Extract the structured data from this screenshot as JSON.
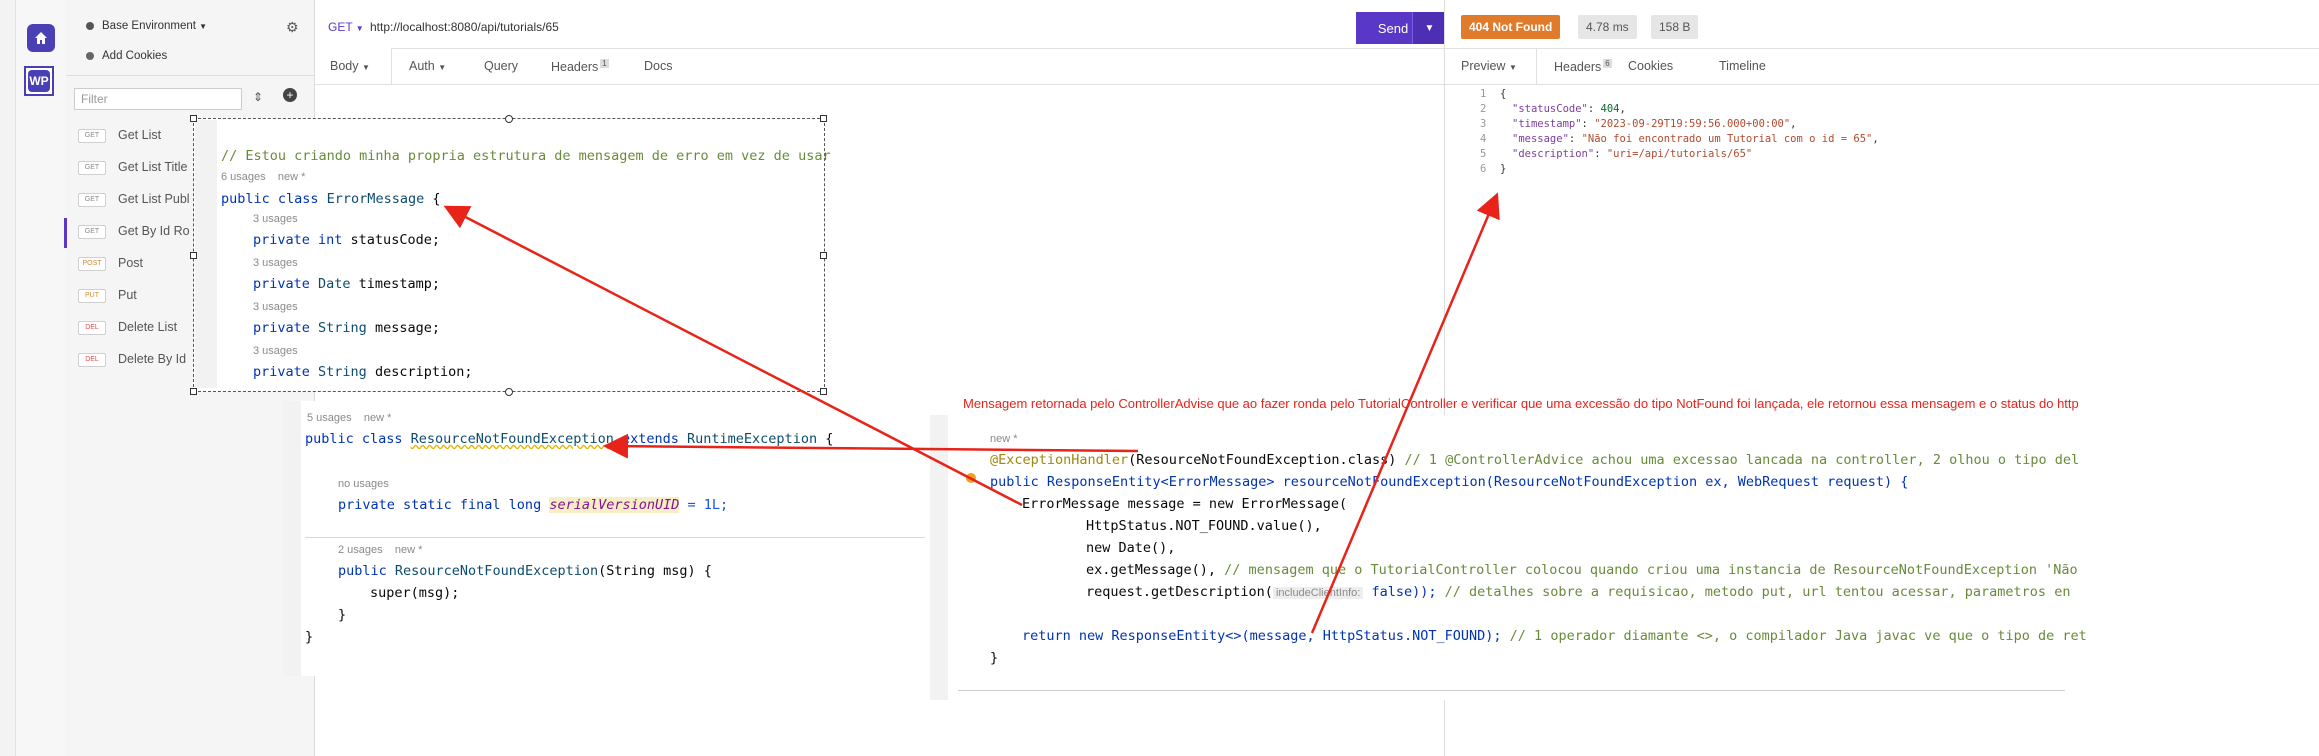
{
  "rail": {
    "home_icon": "home-icon",
    "workspace_initials": "WP"
  },
  "sidebar": {
    "environment": "Base Environment",
    "add_cookies": "Add Cookies",
    "filter_placeholder": "Filter",
    "requests": [
      {
        "method": "GET",
        "name": "Get List"
      },
      {
        "method": "GET",
        "name": "Get List Title"
      },
      {
        "method": "GET",
        "name": "Get List Publ"
      },
      {
        "method": "GET",
        "name": "Get By Id Ro"
      },
      {
        "method": "POST",
        "name": "Post"
      },
      {
        "method": "PUT",
        "name": "Put"
      },
      {
        "method": "DEL",
        "name": "Delete List"
      },
      {
        "method": "DEL",
        "name": "Delete By Id"
      }
    ]
  },
  "request": {
    "method": "GET",
    "url": "http://localhost:8080/api/tutorials/65",
    "send_label": "Send",
    "tabs": [
      "Body",
      "Auth",
      "Query",
      "Headers",
      "Docs"
    ],
    "headers_count": "1"
  },
  "response": {
    "status": "404 Not Found",
    "time": "4.78 ms",
    "size": "158 B",
    "tabs": [
      "Preview",
      "Headers",
      "Cookies",
      "Timeline"
    ],
    "headers_count": "6",
    "json_lines": [
      {
        "n": "1",
        "text": "{"
      },
      {
        "n": "2",
        "key": "\"statusCode\"",
        "value": "404",
        "kind": "num"
      },
      {
        "n": "3",
        "key": "\"timestamp\"",
        "value": "\"2023-09-29T19:59:56.000+00:00\"",
        "kind": "str"
      },
      {
        "n": "4",
        "key": "\"message\"",
        "value": "\"Não foi encontrado um Tutorial com o id = 65\"",
        "kind": "str"
      },
      {
        "n": "5",
        "key": "\"description\"",
        "value": "\"uri=/api/tutorials/65\"",
        "kind": "str"
      },
      {
        "n": "6",
        "text": "}"
      }
    ]
  },
  "code1": {
    "comment": "// Estou criando minha propria estrutura de mensagem de erro em vez de usar",
    "usages_class": "6 usages",
    "new_tag": "new *",
    "class_decl_kw": "public class ",
    "class_name": "ErrorMessage",
    "brace": " {",
    "fields": [
      {
        "usages": "3 usages",
        "kw": "private ",
        "type": "int",
        "name": " statusCode;"
      },
      {
        "usages": "3 usages",
        "kw": "private ",
        "type": "Date",
        "name": " timestamp;"
      },
      {
        "usages": "3 usages",
        "kw": "private ",
        "type": "String",
        "name": " message;"
      },
      {
        "usages": "3 usages",
        "kw": "private ",
        "type": "String",
        "name": " description;"
      }
    ]
  },
  "code2": {
    "usages": "5 usages",
    "new_tag": "new *",
    "decl_kw": "public class ",
    "class_name": "ResourceNotFoundException",
    "extends_kw": " extends ",
    "parent": "RuntimeException",
    "brace": " {",
    "no_usages": "no usages",
    "serial_kw": "private static final long ",
    "serial_name": "serialVersionUID",
    "serial_val": " = 1L;",
    "ctor_usages": "2 usages",
    "ctor_new": "new *",
    "ctor_kw": "public ",
    "ctor_name": "ResourceNotFoundException",
    "ctor_params": "(String msg) {",
    "super_call": "super(msg);",
    "close_inner": "}",
    "close_outer": "}"
  },
  "code3": {
    "new_tag": "new *",
    "line1_ann": "@ExceptionHandler",
    "line1_rest": "(ResourceNotFoundException.class)",
    "line1_comment": " // 1 @ControllerAdvice achou uma excessao lancada na controller, 2 olhou o tipo del",
    "line2": "public ResponseEntity<ErrorMessage> resourceNotFoundException(ResourceNotFoundException ex, WebRequest request) {",
    "line3": "ErrorMessage message = new ErrorMessage(",
    "line4": "HttpStatus.NOT_FOUND.value(),",
    "line5": "new Date(),",
    "line6": "ex.getMessage(),",
    "line6_comment": " // mensagem que o TutorialController colocou quando criou uma instancia de ResourceNotFoundException 'Não",
    "line7_a": "request.getDescription(",
    "line7_hint": "includeClientInfo:",
    "line7_b": " false));",
    "line7_comment": " // detalhes sobre a requisicao, metodo put, url tentou acessar, parametros en",
    "line8": "return new ResponseEntity<>(message, HttpStatus.NOT_FOUND);",
    "line8_comment": " // 1 operador diamante <>, o compilador Java javac ve que o tipo de ret",
    "line9": "}"
  },
  "annotation": "Mensagem retornada pelo ControllerAdvise que ao fazer ronda pelo TutorialController e verificar que uma excessão do tipo NotFound foi lançada, ele retornou essa mensagem e o status do http",
  "colors": {
    "accent": "#5a38c7",
    "status_bg": "#e07b2c",
    "arrow": "#e8231a"
  }
}
